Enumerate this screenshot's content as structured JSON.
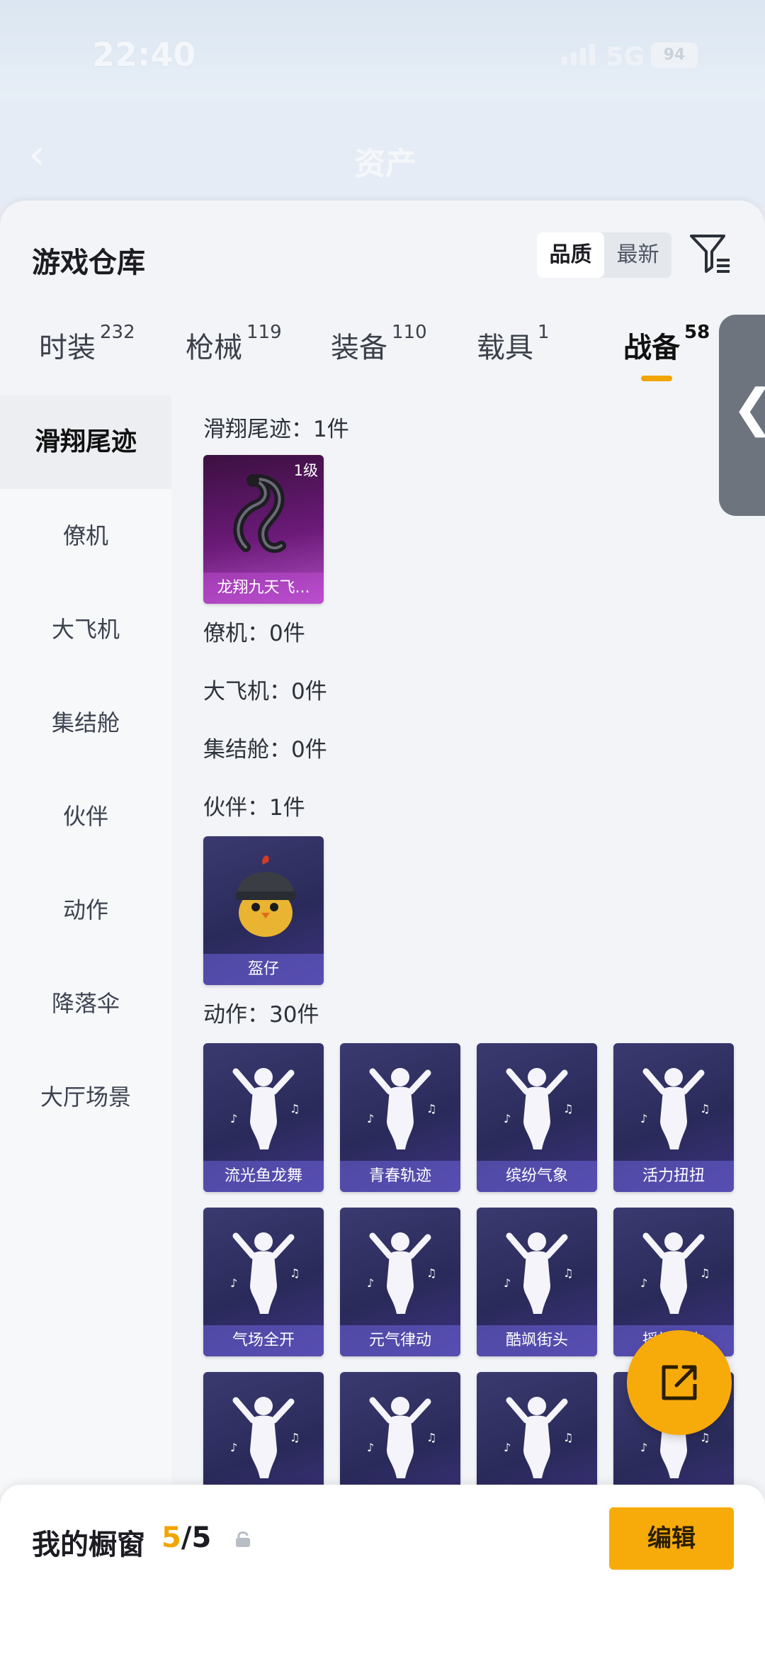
{
  "status_bar": {
    "time": "22:40",
    "network": "5G",
    "battery": "94"
  },
  "nav": {
    "title": "资产"
  },
  "warehouse": {
    "title": "游戏仓库",
    "sort": {
      "quality": "品质",
      "newest": "最新",
      "selected": "quality"
    },
    "tabs": [
      {
        "label": "时装",
        "count": "232"
      },
      {
        "label": "枪械",
        "count": "119"
      },
      {
        "label": "装备",
        "count": "110"
      },
      {
        "label": "载具",
        "count": "1"
      },
      {
        "label": "战备",
        "count": "58",
        "active": true
      }
    ],
    "categories": [
      "滑翔尾迹",
      "僚机",
      "大飞机",
      "集结舱",
      "伙伴",
      "动作",
      "降落伞",
      "大厅场景"
    ],
    "sections": {
      "glide": {
        "label": "滑翔尾迹：1件",
        "items": [
          {
            "name": "龙翔九天飞...",
            "level": "1级",
            "rarity": "legendary",
            "icon": "dragon-icon"
          }
        ]
      },
      "wingman": {
        "label": "僚机：0件"
      },
      "plane": {
        "label": "大飞机：0件"
      },
      "pod": {
        "label": "集结舱：0件"
      },
      "partner": {
        "label": "伙伴：1件",
        "items": [
          {
            "name": "盔仔",
            "icon": "helmet-chick-icon"
          }
        ]
      },
      "emote": {
        "label": "动作：30件",
        "items": [
          {
            "name": "流光鱼龙舞"
          },
          {
            "name": "青春轨迹"
          },
          {
            "name": "缤纷气象"
          },
          {
            "name": "活力扭扭"
          },
          {
            "name": "气场全开"
          },
          {
            "name": "元气律动"
          },
          {
            "name": "酷飒街头"
          },
          {
            "name": "摇摆韵力"
          },
          {
            "name": ""
          },
          {
            "name": ""
          },
          {
            "name": ""
          },
          {
            "name": ""
          }
        ]
      }
    }
  },
  "showcase": {
    "label": "我的橱窗",
    "count": "5",
    "total": "5",
    "edit": "编辑"
  },
  "colors": {
    "accent": "#f7ab0a",
    "card": "#2d2d60",
    "legendary": "#b04ec4"
  }
}
